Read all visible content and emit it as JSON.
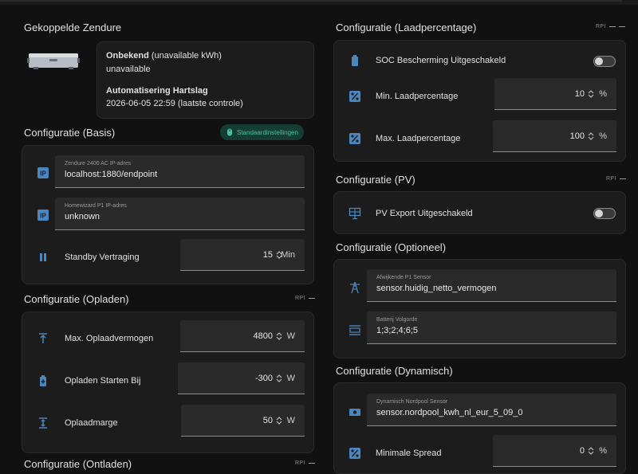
{
  "colors": {
    "icon": "#4b86bf",
    "chip_bg": "#163d33",
    "chip_fg": "#46c39a",
    "card": "#1c1c1c",
    "bg": "#111111"
  },
  "left": {
    "linked": {
      "title": "Gekoppelde Zendure",
      "status_bold": "Onbekend",
      "status_rest": "(unavailable kWh)",
      "status_value": "unavailable",
      "heartbeat_title": "Automatisering Hartslag",
      "heartbeat_value": "2026-06-05 22:59 (laatste controle)"
    },
    "basis": {
      "title": "Configuratie (Basis)",
      "chip_label": "Standaardinstellingen",
      "chip_icon": "mouse-icon",
      "ip_label": "Zendure 2400 AC IP-adres",
      "ip_value": "localhost:1880/endpoint",
      "p1_label": "Homewizard P1 IP-adres",
      "p1_value": "unknown",
      "standby_label": "Standby Vertraging",
      "standby_value": "15",
      "standby_unit": "Min"
    },
    "opladen": {
      "title": "Configuratie (Opladen)",
      "tools": "RPI",
      "max_label": "Max. Oplaadvermogen",
      "max_value": "4800",
      "max_unit": "W",
      "start_label": "Opladen Starten Bij",
      "start_value": "-300",
      "start_unit": "W",
      "marge_label": "Oplaadmarge",
      "marge_value": "50",
      "marge_unit": "W"
    },
    "ontladen": {
      "title": "Configuratie (Ontladen)",
      "tools": "RPI"
    }
  },
  "right": {
    "laad": {
      "title": "Configuratie (Laadpercentage)",
      "tools": "RPI",
      "soc_label": "SOC Bescherming Uitgeschakeld",
      "soc_on": false,
      "min_label": "Min. Laadpercentage",
      "min_value": "10",
      "min_unit": "%",
      "max_label": "Max. Laadpercentage",
      "max_value": "100",
      "max_unit": "%"
    },
    "pv": {
      "title": "Configuratie (PV)",
      "tools": "RPI",
      "export_label": "PV Export Uitgeschakeld",
      "export_on": false
    },
    "optioneel": {
      "title": "Configuratie (Optioneel)",
      "p1_label": "Afwijkende P1 Sensor",
      "p1_value": "sensor.huidig_netto_vermogen",
      "order_label": "Batterij Volgorde",
      "order_value": "1;3;2;4;6;5"
    },
    "dynamisch": {
      "title": "Configuratie (Dynamisch)",
      "sensor_label": "Dynamisch Nordpool Sensor",
      "sensor_value": "sensor.nordpool_kwh_nl_eur_5_09_0",
      "spread_label": "Minimale Spread",
      "spread_value": "0",
      "spread_unit": "%"
    }
  }
}
